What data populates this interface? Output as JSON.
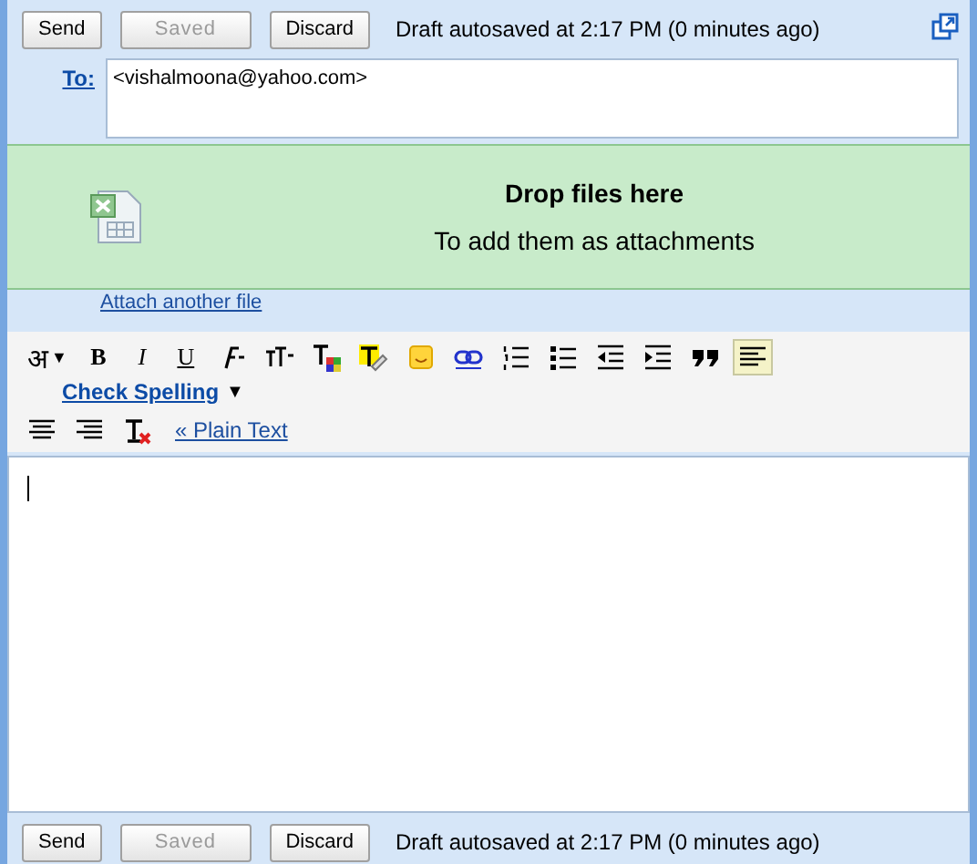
{
  "top_bar": {
    "buttons": [
      {
        "label": "Send",
        "disabled": false
      },
      {
        "label": "Saved",
        "disabled": true
      },
      {
        "label": "Discard",
        "disabled": false
      }
    ],
    "status": "Draft autosaved at 2:17 PM (0 minutes ago)"
  },
  "to": {
    "label": "To:",
    "value": "<vishalmoona@yahoo.com>"
  },
  "drop_zone": {
    "title": "Drop files here",
    "subtitle": "To add them as attachments"
  },
  "attach_link": "Attach another file",
  "toolbar": {
    "items": [
      {
        "kind": "text",
        "label": "अ",
        "caret": "▼",
        "selected": false
      },
      {
        "kind": "bold",
        "label": "B",
        "selected": false
      },
      {
        "kind": "italic",
        "label": "I",
        "selected": false
      },
      {
        "kind": "underline",
        "label": "U",
        "selected": false
      },
      {
        "kind": "font",
        "selected": false
      },
      {
        "kind": "size",
        "selected": false
      },
      {
        "kind": "color",
        "selected": false
      },
      {
        "kind": "highlight",
        "selected": false
      },
      {
        "kind": "emoji",
        "selected": false
      },
      {
        "kind": "link",
        "selected": false
      },
      {
        "kind": "numbered",
        "selected": false
      },
      {
        "kind": "bulleted",
        "selected": false
      },
      {
        "kind": "outdent",
        "selected": false
      },
      {
        "kind": "indent",
        "selected": false
      },
      {
        "kind": "quote",
        "selected": false
      },
      {
        "kind": "align-left",
        "selected": true
      },
      {
        "kind": "align-center",
        "selected": false
      },
      {
        "kind": "align-right",
        "selected": false
      },
      {
        "kind": "clear",
        "selected": false
      }
    ],
    "spell_link": "Check Spelling",
    "spell_caret": "▼",
    "plain_link": "« Plain Text"
  },
  "bottom_bar": {
    "buttons": [
      {
        "label": "Send",
        "disabled": false
      },
      {
        "label": "Saved",
        "disabled": true
      },
      {
        "label": "Discard",
        "disabled": false
      }
    ],
    "status": "Draft autosaved at 2:17 PM (0 minutes ago)"
  }
}
